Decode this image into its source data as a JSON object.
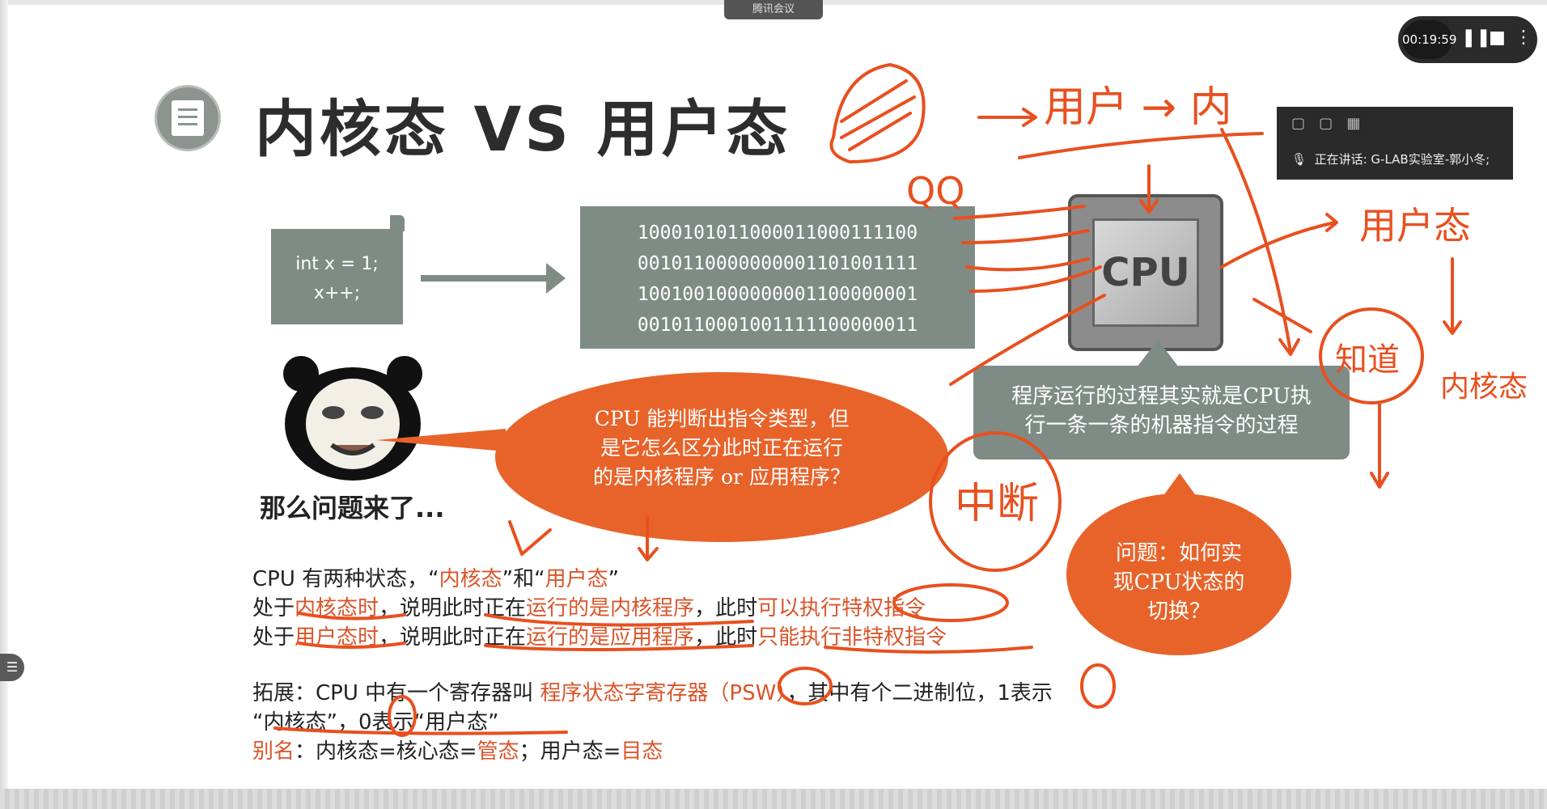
{
  "meeting": {
    "label": "腾讯会议"
  },
  "recorder": {
    "time": "00:19:59",
    "pause_icon": "pause-icon",
    "stop_icon": "stop-icon",
    "more_icon": "more-icon"
  },
  "speaker_panel": {
    "speaking_text": "正在讲话: G-LAB实验室-郭小冬;"
  },
  "side_tab": {
    "icon": "menu-icon"
  },
  "slide": {
    "title": "内核态 VS 用户态",
    "code_lines": [
      "int x = 1;",
      "x++;"
    ],
    "binary_lines": [
      "1000101011000011000111100",
      "0010110000000001101001111",
      "1001001000000001100000001",
      "0010110001001111100000011"
    ],
    "cpu_label": "CPU",
    "info_box": [
      "程序运行的过程其实就是CPU执",
      "行一条一条的机器指令的过程"
    ],
    "bubble": [
      "CPU 能判断出指令类型，但",
      "是它怎么区分此时正在运行",
      "的是内核程序 or 应用程序？"
    ],
    "panda_caption": "那么问题来了...",
    "question": [
      "问题：如何实",
      "现CPU状态的",
      "切换？"
    ],
    "lines": {
      "l1_a": "CPU 有两种状态，“",
      "l1_b": "内核态",
      "l1_c": "”和“",
      "l1_d": "用户态",
      "l1_e": "”",
      "l2_a": "处于",
      "l2_b": "内核态时",
      "l2_c": "，说明此时正在",
      "l2_d": "运行的是内核程序",
      "l2_e": "，此时",
      "l2_f": "可以执行特权指令",
      "l3_a": "处于",
      "l3_b": "用户态时",
      "l3_c": "，说明此时正在",
      "l3_d": "运行的是应用程序",
      "l3_e": "，此时",
      "l3_f": "只能执行非特权指令",
      "l4_a": "拓展：CPU 中有一个寄存器叫 ",
      "l4_b": "程序状态字寄存器（PSW）",
      "l4_c": "，其中有个二进制位，1表示",
      "l5_a": "“内核态”，0表示“用户态”",
      "l6_a": "别名",
      "l6_b": "：内核态=核心态=",
      "l6_c": "管态",
      "l6_d": "；用户态=",
      "l6_e": "目态"
    }
  },
  "handwriting": {
    "qq": "QQ",
    "user_to_kernel": "用户 → 内",
    "user_state": "用户态",
    "know": "知道",
    "kernel_state": "内核态",
    "interrupt": "中断"
  },
  "colors": {
    "accent_orange": "#e8632a",
    "slide_gray": "#7f8c86",
    "ink_red": "#e8501f"
  }
}
